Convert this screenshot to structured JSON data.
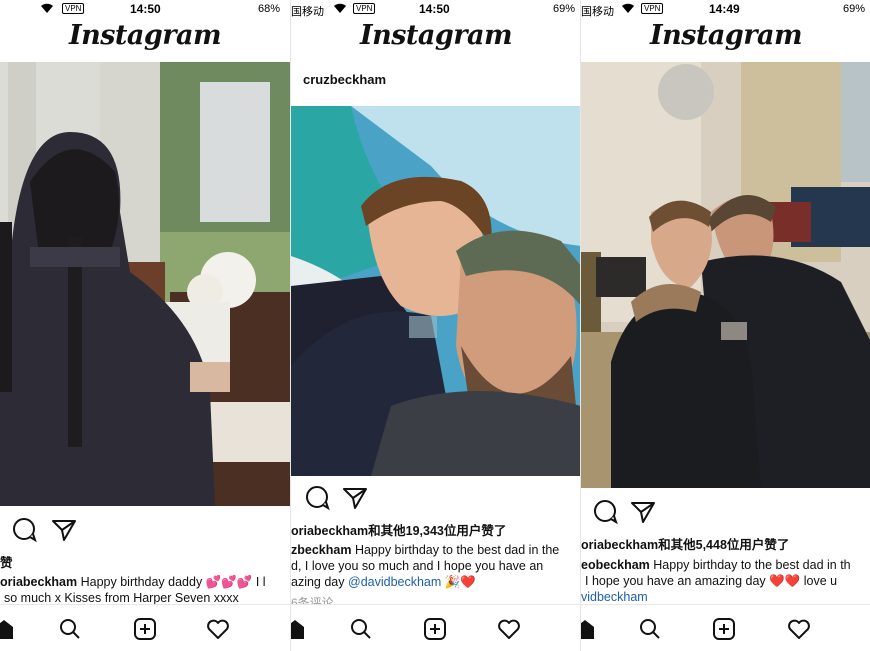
{
  "status_bars": [
    {
      "time": "14:50",
      "carrier": "",
      "vpn": "VPN",
      "battery": "68%"
    },
    {
      "time": "14:50",
      "carrier": "国移动",
      "vpn": "VPN",
      "battery": "69%"
    },
    {
      "time": "14:49",
      "carrier": "国移动",
      "vpn": "VPN",
      "battery": "69%"
    }
  ],
  "app_name": "Instagram",
  "posts": [
    {
      "username": "",
      "likes": "赞",
      "caption_user": "oriabeckham",
      "caption_text": "Happy birthday daddy 💕💕💕 I l",
      "caption_line2": "so much x Kisses from Harper Seven xxxx",
      "comments": ""
    },
    {
      "username": "cruzbeckham",
      "likes": "oriabeckham和其他19,343位用户赞了",
      "caption_user": "zbeckham",
      "caption_text": "Happy birthday to the best dad in the",
      "caption_line2": "d, I love you so much and I hope you have an",
      "caption_line3_pre": "azing day",
      "caption_mention": "@davidbeckham",
      "caption_line3_post": "🎉❤️",
      "comments": "6条评论"
    },
    {
      "username": "",
      "likes": "oriabeckham和其他5,448位用户赞了",
      "caption_user": "eobeckham",
      "caption_text": "Happy birthday to the best dad in th",
      "caption_line2": "I hope you have an amazing day ❤️❤️ love u",
      "caption_mention": "vidbeckham",
      "comments": ""
    }
  ],
  "icons": {
    "comment": "comment-icon",
    "share": "share-icon",
    "home": "home-icon",
    "search": "search-icon",
    "add": "add-post-icon",
    "heart": "heart-icon"
  },
  "colors": {
    "mention": "#1d5fa8",
    "muted": "#999999",
    "text": "#111111"
  }
}
